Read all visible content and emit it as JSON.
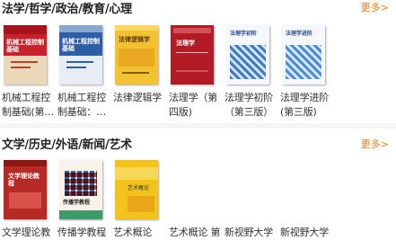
{
  "sections": [
    {
      "title": "法学/哲学/政治/教育/心理",
      "more": "更多>",
      "books": [
        {
          "title_line1": "机械工程控",
          "title_line2": "制基础(第…",
          "cover_text": "机械工程控制基础"
        },
        {
          "title_line1": "机械工程控",
          "title_line2": "制基础：…",
          "cover_text": "机械工程控制基础"
        },
        {
          "title_line1": "法律逻辑学",
          "title_line2": "",
          "cover_text": "法律逻辑学"
        },
        {
          "title_line1": "法理学（第",
          "title_line2": "四版)",
          "cover_text": "法理学"
        },
        {
          "title_line1": "法理学初阶",
          "title_line2": "（第三版）",
          "cover_text": "法理学初阶"
        },
        {
          "title_line1": "法理学进阶",
          "title_line2": "(第三版)",
          "cover_text": "法理学进阶"
        }
      ]
    },
    {
      "title": "文学/历史/外语/新闻/艺术",
      "more": "更多>",
      "books": [
        {
          "title_line1": "文学理论教",
          "title_line2": "",
          "cover_text": "文学理论教程"
        },
        {
          "title_line1": "传播学教程",
          "title_line2": "",
          "cover_text": "传播学教程"
        },
        {
          "title_line1": "艺术概论",
          "title_line2": "",
          "cover_text": "艺术概论"
        },
        {
          "title_line1": "艺术概论 第",
          "title_line2": ""
        },
        {
          "title_line1": "新视野大学",
          "title_line2": ""
        },
        {
          "title_line1": "新视野大学",
          "title_line2": ""
        }
      ]
    }
  ]
}
